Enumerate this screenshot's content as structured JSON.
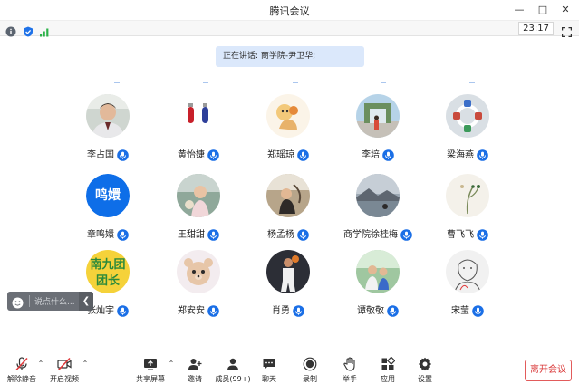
{
  "window": {
    "title": "腾讯会议"
  },
  "infobar": {
    "timer": "23:17"
  },
  "speaking": {
    "text": "正在讲话: 商学院-尹卫华;"
  },
  "participants": [
    {
      "name": "李占国",
      "avatar": "photo-man"
    },
    {
      "name": "黄怡婕",
      "avatar": "photo-objects"
    },
    {
      "name": "郑瑶琼",
      "avatar": "photo-cartoon"
    },
    {
      "name": "李培",
      "avatar": "photo-gate"
    },
    {
      "name": "梁海燕",
      "avatar": "photo-toy"
    },
    {
      "name": "章鸣嬛",
      "avatar": "text",
      "avatar_text": "鸣嬛"
    },
    {
      "name": "王甜甜",
      "avatar": "photo-child"
    },
    {
      "name": "杨孟杨",
      "avatar": "photo-beach"
    },
    {
      "name": "商学院徐桂梅",
      "avatar": "photo-sea"
    },
    {
      "name": "曹飞飞",
      "avatar": "photo-plant"
    },
    {
      "name": "张灿宇",
      "avatar": "photo-text-yellow",
      "avatar_text": "南九团团长"
    },
    {
      "name": "郑安安",
      "avatar": "photo-bear"
    },
    {
      "name": "肖勇",
      "avatar": "photo-basketball"
    },
    {
      "name": "谭敬敬",
      "avatar": "photo-family"
    },
    {
      "name": "宋莹",
      "avatar": "photo-sketch"
    }
  ],
  "chat": {
    "placeholder": "说点什么...",
    "collapse_icon": "chevron-left-icon"
  },
  "toolbar": {
    "unmute_label": "解除静音",
    "start_video_label": "开启视频",
    "share_screen_label": "共享屏幕",
    "invite_label": "邀请",
    "members_label": "成员(99+)",
    "chat_label": "聊天",
    "record_label": "录制",
    "raise_hand_label": "举手",
    "apps_label": "应用",
    "settings_label": "设置",
    "leave_label": "离开会议"
  },
  "colors": {
    "accent": "#0e6ee8",
    "leave": "#d93636",
    "speaking_bg": "#dbe8fb",
    "muted_red": "#e0393b"
  }
}
